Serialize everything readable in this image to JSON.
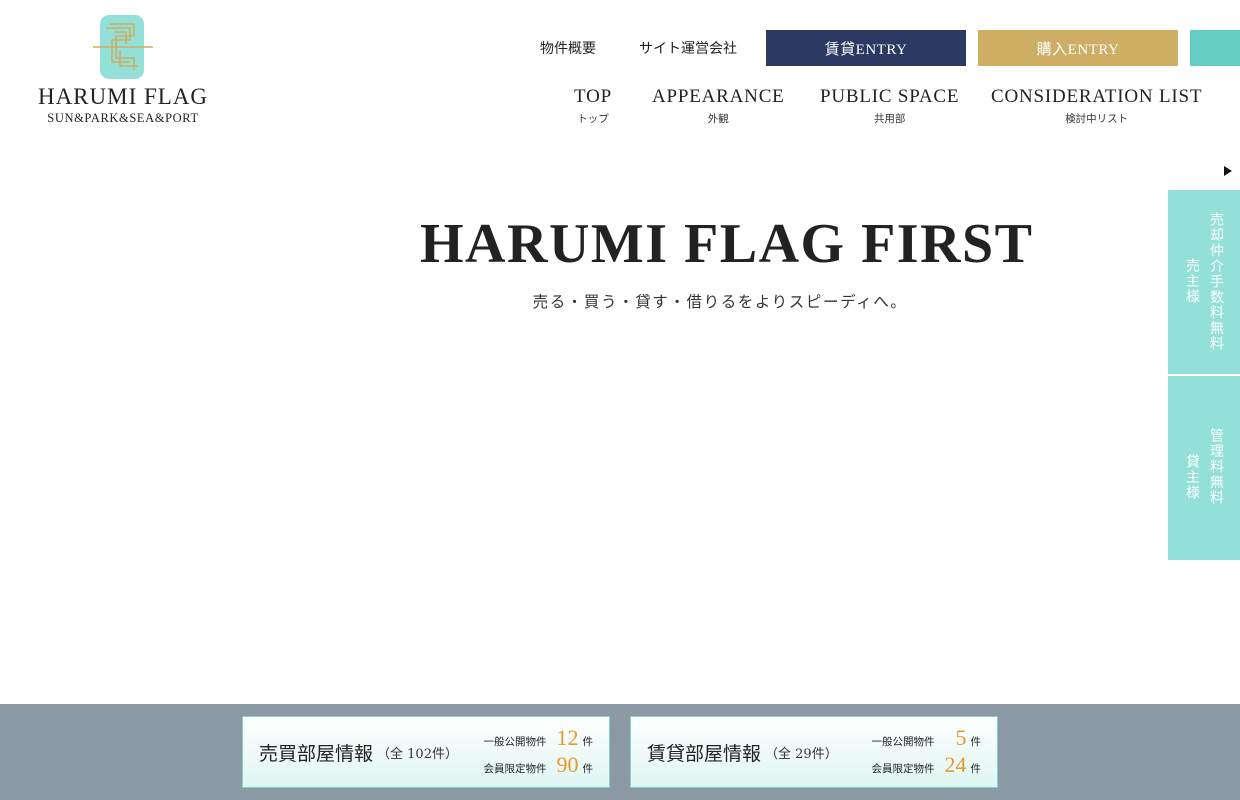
{
  "header": {
    "logo": {
      "title": "HARUMI FLAG",
      "subtitle": "SUN&PARK&SEA&PORT",
      "mark_color": "#93e0d8",
      "mark_accent": "#cdae64"
    },
    "util_links": {
      "overview": "物件概要",
      "operator": "サイト運営会社"
    },
    "entry_buttons": {
      "rent": "賃貸ENTRY",
      "buy": "購入ENTRY",
      "rent_color": "#2c3a63",
      "buy_color": "#cdae64",
      "extra_color": "#66cdc4"
    },
    "nav": [
      {
        "en": "TOP",
        "ja": "トップ"
      },
      {
        "en": "APPEARANCE",
        "ja": "外観"
      },
      {
        "en": "PUBLIC SPACE",
        "ja": "共用部"
      },
      {
        "en": "CONSIDERATION LIST",
        "ja": "検討中リスト"
      }
    ]
  },
  "hero": {
    "title": "HARUMI FLAG FIRST",
    "subtitle": "売る・買う・貸す・借りるをよりスピーディへ。"
  },
  "side_panel": {
    "tab_color": "#93e0d8",
    "tabs": [
      {
        "main": "売却仲介手数料無料",
        "sub": "売主様"
      },
      {
        "main": "管理料無料",
        "sub": "貸主様"
      }
    ]
  },
  "bottom_bar": {
    "background": "#8b99a4",
    "cards": [
      {
        "title": "売買部屋情報",
        "total": "（全 102件）",
        "public_label": "一般公開物件",
        "public_count": "12",
        "member_label": "会員限定物件",
        "member_count": "90",
        "unit": "件"
      },
      {
        "title": "賃貸部屋情報",
        "total": "（全 29件）",
        "public_label": "一般公開物件",
        "public_count": "5",
        "member_label": "会員限定物件",
        "member_count": "24",
        "unit": "件"
      }
    ],
    "count_color": "#e69a2a"
  }
}
